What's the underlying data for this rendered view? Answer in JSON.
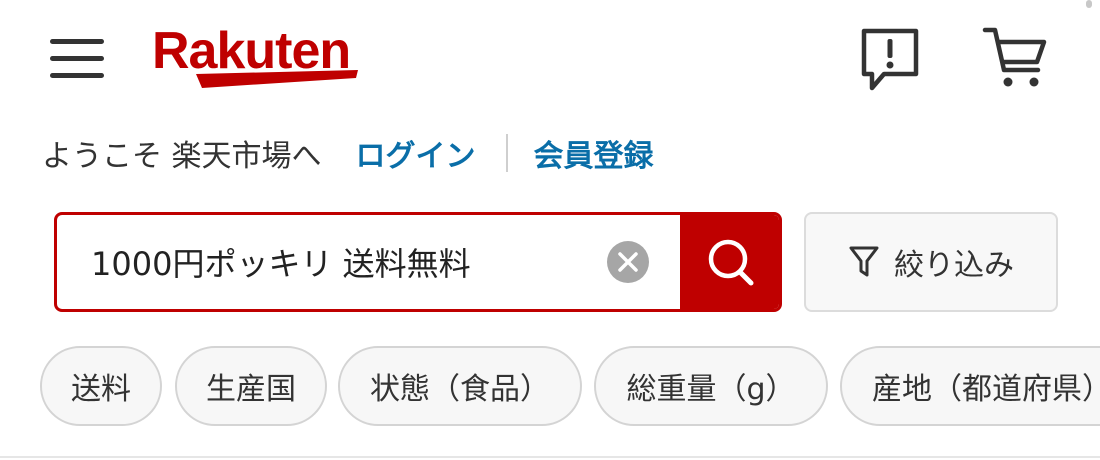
{
  "header": {
    "logo_text": "Rakuten",
    "brand_color": "#bf0000",
    "menu_icon": "hamburger-menu-icon",
    "notice_icon": "speech-bubble-exclamation-icon",
    "cart_icon": "shopping-cart-icon"
  },
  "welcome": {
    "text": "ようこそ 楽天市場へ",
    "login_label": "ログイン",
    "register_label": "会員登録",
    "link_color": "#0a6ea8"
  },
  "search": {
    "value": "1000円ポッキリ 送料無料",
    "clear_icon": "clear-circle-icon",
    "search_icon": "search-icon"
  },
  "filter": {
    "label": "絞り込み",
    "icon": "funnel-icon"
  },
  "chips": [
    {
      "label": "送料"
    },
    {
      "label": "生産国"
    },
    {
      "label": "状態（食品）"
    },
    {
      "label": "総重量（g）"
    },
    {
      "label": "産地（都道府県）"
    }
  ]
}
